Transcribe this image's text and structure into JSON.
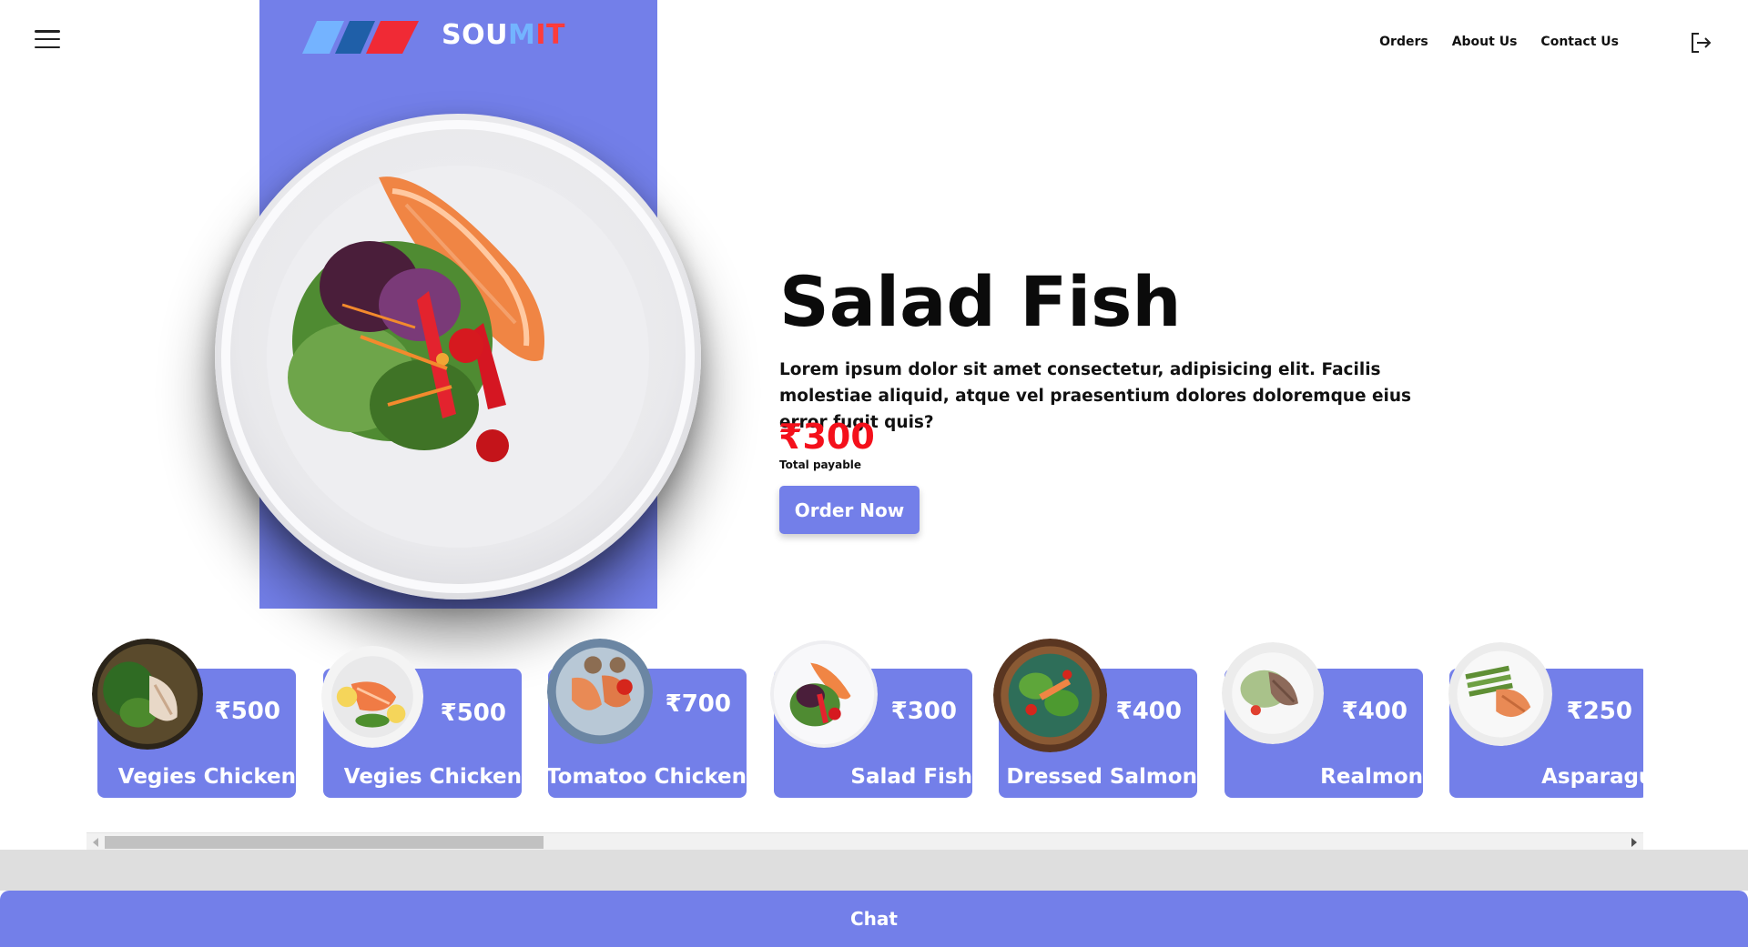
{
  "brand": {
    "name_part1": "SOU",
    "name_part2": "M",
    "name_part3": "I",
    "name_part4": "T",
    "colors": {
      "primary": "#737fe9",
      "price_red": "#f4101b",
      "logo_blue": "#73b4ff",
      "logo_red": "#ff3b3b"
    }
  },
  "header": {
    "menu_icon": "hamburger-menu-icon",
    "nav": [
      "Orders",
      "About Us",
      "Contact Us"
    ],
    "logout_icon": "logout-icon"
  },
  "hero": {
    "title": "Salad Fish",
    "description": "Lorem ipsum dolor sit amet consectetur, adipisicing elit. Facilis molestiae aliquid, atque vel praesentium dolores doloremque eius error fugit quis?",
    "price": "₹300",
    "price_label": "Total payable",
    "order_button": "Order Now"
  },
  "menu_items": [
    {
      "name": "Vegies Chicken",
      "price": "₹500"
    },
    {
      "name": "Vegies Chicken",
      "price": "₹500"
    },
    {
      "name": "Tomatoo Chicken",
      "price": "₹700"
    },
    {
      "name": "Salad Fish",
      "price": "₹300"
    },
    {
      "name": "Dressed Salmon",
      "price": "₹400"
    },
    {
      "name": "Realmon",
      "price": "₹400"
    },
    {
      "name": "Asparagus",
      "price": "₹250"
    }
  ],
  "scrollbar": {
    "position": 0.28
  },
  "chat": {
    "label": "Chat"
  }
}
